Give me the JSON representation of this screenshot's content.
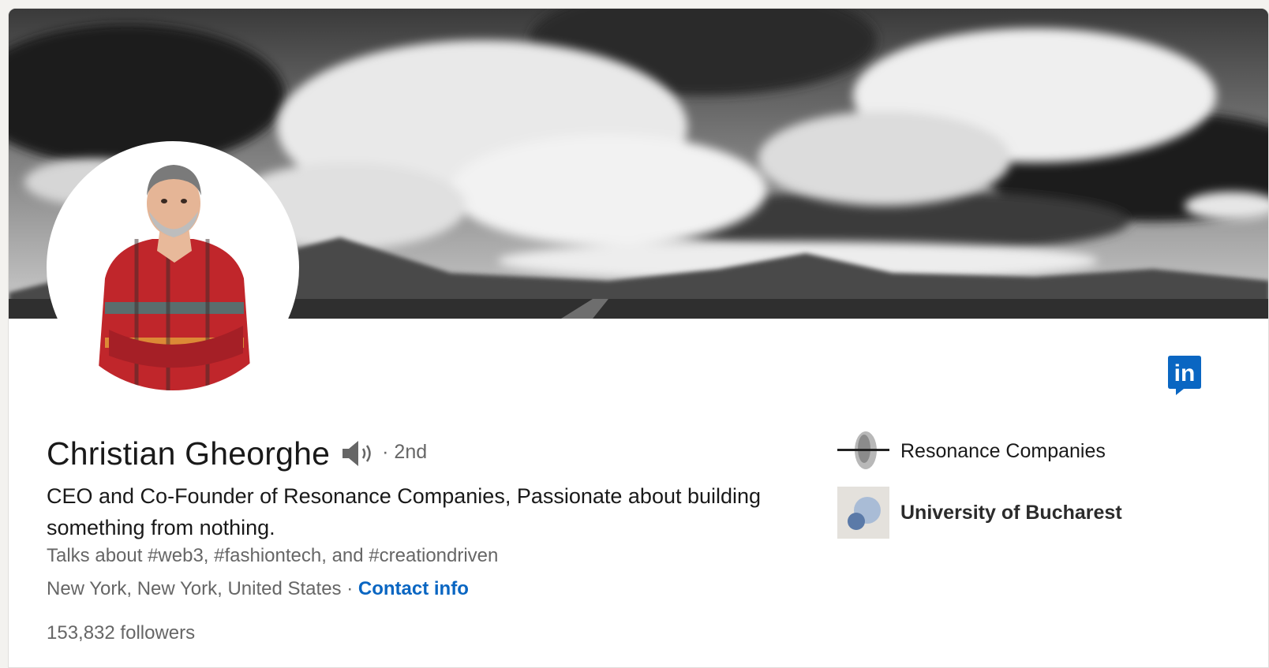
{
  "profile": {
    "name": "Christian Gheorghe",
    "degree": "· 2nd",
    "headline": "CEO and Co-Founder of Resonance Companies, Passionate about building something from nothing.",
    "talks_about": "Talks about #web3, #fashiontech, and #creationdriven",
    "location": "New York, New York, United States",
    "location_separator": " · ",
    "contact_info_label": "Contact info",
    "followers": "153,832 followers"
  },
  "organizations": [
    {
      "name": "Resonance Companies",
      "logo_icon": "resonance-logo-icon"
    },
    {
      "name": "University of Bucharest",
      "logo_icon": "university-logo-icon"
    }
  ],
  "icons": {
    "badge": "linkedin-icon",
    "pronunciation": "speaker-icon"
  },
  "colors": {
    "link": "#0a66c2",
    "linkedin_blue": "#0a66c2",
    "text_primary": "#191919",
    "text_secondary": "#666666"
  }
}
